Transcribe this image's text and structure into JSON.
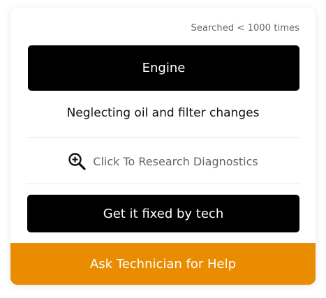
{
  "search_count": "Searched < 1000 times",
  "category": "Engine",
  "problem": "Neglecting oil and filter changes",
  "research": {
    "label": "Click To Research Diagnostics",
    "icon": "zoom-in-icon"
  },
  "fix_button_label": "Get it fixed by tech",
  "ask_button_label": "Ask Technician for Help",
  "colors": {
    "accent": "#ea8c00",
    "dark": "#000000",
    "muted_text": "#666666"
  }
}
